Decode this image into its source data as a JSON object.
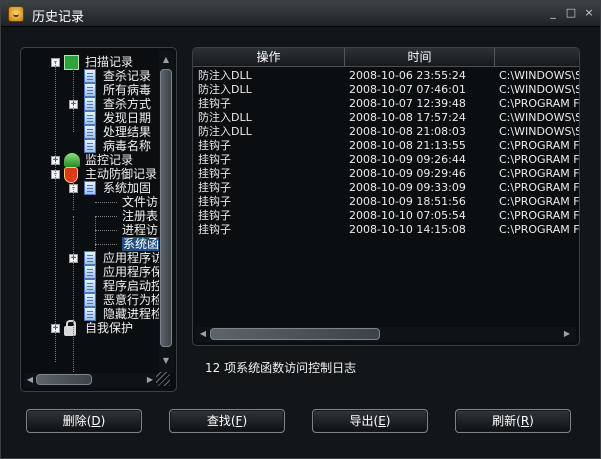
{
  "window": {
    "title": "历史记录",
    "minimize": "_",
    "maximize": "□",
    "close": "×"
  },
  "tree": {
    "items": [
      {
        "label": "扫描记录",
        "level": 1,
        "icon": "scan-icon",
        "expander": "-"
      },
      {
        "label": "查杀记录",
        "level": 2,
        "icon": "document-icon"
      },
      {
        "label": "所有病毒",
        "level": 2,
        "icon": "document-icon"
      },
      {
        "label": "查杀方式",
        "level": 2,
        "icon": "document-icon",
        "expander": "+"
      },
      {
        "label": "发现日期",
        "level": 2,
        "icon": "document-icon"
      },
      {
        "label": "处理结果",
        "level": 2,
        "icon": "document-icon"
      },
      {
        "label": "病毒名称",
        "level": 2,
        "icon": "document-icon"
      },
      {
        "label": "监控记录",
        "level": 1,
        "icon": "monitor-icon",
        "expander": "+"
      },
      {
        "label": "主动防御记录",
        "level": 1,
        "icon": "shield-icon",
        "expander": "-"
      },
      {
        "label": "系统加固",
        "level": 2,
        "icon": "document-icon",
        "expander": "-"
      },
      {
        "label": "文件访",
        "level": 3
      },
      {
        "label": "注册表",
        "level": 3
      },
      {
        "label": "进程访",
        "level": 3
      },
      {
        "label": "系统函",
        "level": 3,
        "selected": true
      },
      {
        "label": "应用程序访",
        "level": 2,
        "icon": "document-icon",
        "expander": "+"
      },
      {
        "label": "应用程序保",
        "level": 2,
        "icon": "document-icon"
      },
      {
        "label": "程序启动控",
        "level": 2,
        "icon": "document-icon"
      },
      {
        "label": "恶意行为检",
        "level": 2,
        "icon": "document-icon"
      },
      {
        "label": "隐藏进程检",
        "level": 2,
        "icon": "document-icon"
      },
      {
        "label": "自我保护",
        "level": 1,
        "icon": "lock-icon",
        "expander": "+"
      }
    ]
  },
  "list": {
    "columns": [
      "操作",
      "时间",
      ""
    ],
    "rows": [
      [
        "防注入DLL",
        "2008-10-06 23:55:24",
        "C:\\WINDOWS\\S"
      ],
      [
        "防注入DLL",
        "2008-10-07 07:46:01",
        "C:\\WINDOWS\\S"
      ],
      [
        "挂钩子",
        "2008-10-07 12:39:48",
        "C:\\PROGRAM FI"
      ],
      [
        "防注入DLL",
        "2008-10-08 17:57:24",
        "C:\\WINDOWS\\S"
      ],
      [
        "防注入DLL",
        "2008-10-08 21:08:03",
        "C:\\WINDOWS\\S"
      ],
      [
        "挂钩子",
        "2008-10-08 21:13:55",
        "C:\\PROGRAM FI"
      ],
      [
        "挂钩子",
        "2008-10-09 09:26:44",
        "C:\\PROGRAM FI"
      ],
      [
        "挂钩子",
        "2008-10-09 09:29:46",
        "C:\\PROGRAM FI"
      ],
      [
        "挂钩子",
        "2008-10-09 09:33:09",
        "C:\\PROGRAM FI"
      ],
      [
        "挂钩子",
        "2008-10-09 18:51:56",
        "C:\\PROGRAM FI"
      ],
      [
        "挂钩子",
        "2008-10-10 07:05:54",
        "C:\\PROGRAM FI"
      ],
      [
        "挂钩子",
        "2008-10-10 14:15:08",
        "C:\\PROGRAM FI"
      ]
    ]
  },
  "status": "12 项系统函数访问控制日志",
  "buttons": [
    {
      "label": "删除",
      "key": "D"
    },
    {
      "label": "查找",
      "key": "F"
    },
    {
      "label": "导出",
      "key": "E"
    },
    {
      "label": "刷新",
      "key": "R"
    }
  ],
  "icons": {
    "app": "app-icon",
    "scroll_up": "▲",
    "scroll_down": "▼",
    "scroll_left": "◀",
    "scroll_right": "▶",
    "expand": "+",
    "collapse": "-"
  }
}
